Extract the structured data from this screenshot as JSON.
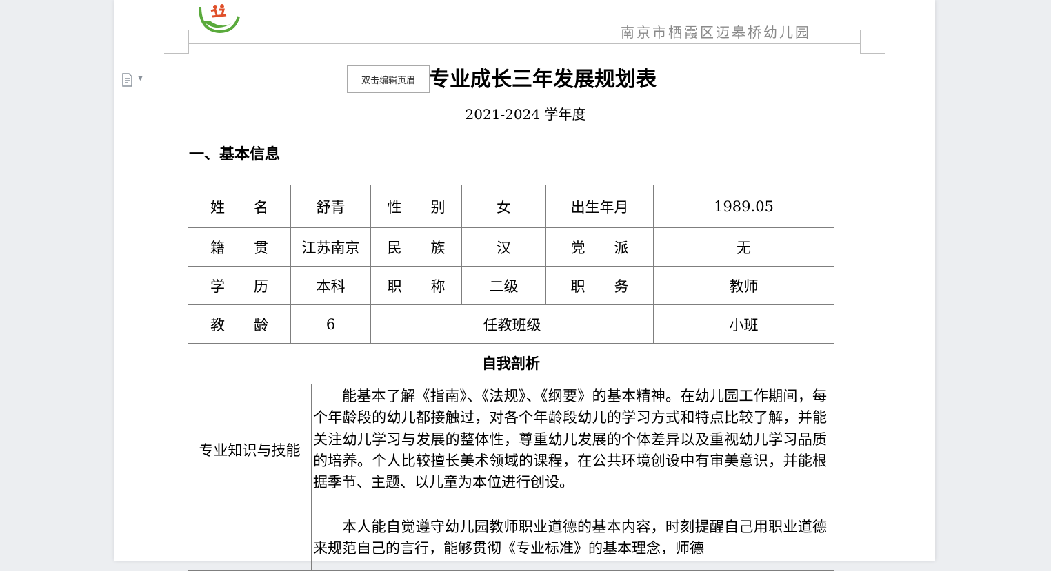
{
  "header": {
    "school_name": "南京市栖霞区迈皋桥幼儿园",
    "edit_hint": "双击编辑页眉"
  },
  "document": {
    "title": "专业成长三年发展规划表",
    "subtitle": "2021-2024 学年度",
    "section_heading": "一、基本信息"
  },
  "basic_info": {
    "row1": [
      "姓　　名",
      "舒青",
      "性　　别",
      "女",
      "出生年月",
      "1989.05"
    ],
    "row2": [
      "籍　　贯",
      "江苏南京",
      "民　　族",
      "汉",
      "党　　派",
      "无"
    ],
    "row3": [
      "学　　历",
      "本科",
      "职　　称",
      "二级",
      "职　　务",
      "教师"
    ],
    "row4": [
      "教　　龄",
      "6",
      "任教班级",
      "小班"
    ],
    "self_analysis_heading": "自我剖析"
  },
  "self_analysis": {
    "knowledge_label": "专业知识与技能",
    "knowledge_text": "能基本了解《指南》、《法规》、《纲要》的基本精神。在幼儿园工作期间，每个年龄段的幼儿都接触过，对各个年龄段幼儿的学习方式和特点比较了解，并能关注幼儿学习与发展的整体性，尊重幼儿发展的个体差异以及重视幼儿学习品质的培养。个人比较擅长美术领域的课程，在公共环境创设中有审美意识，并能根据季节、主题、以儿童为本位进行创设。",
    "ethics_label": "",
    "ethics_text": "本人能自觉遵守幼儿园教师职业道德的基本内容，时刻提醒自己用职业道德来规范自己的言行，能够贯彻《专业标准》的基本理念，师德"
  },
  "icons": {
    "doc_icon": "document-icon",
    "logo": "school-logo"
  },
  "colors": {
    "logo_green": "#5aaa3c",
    "header_gray": "#8a8a8a",
    "border": "#7f7f7f"
  }
}
